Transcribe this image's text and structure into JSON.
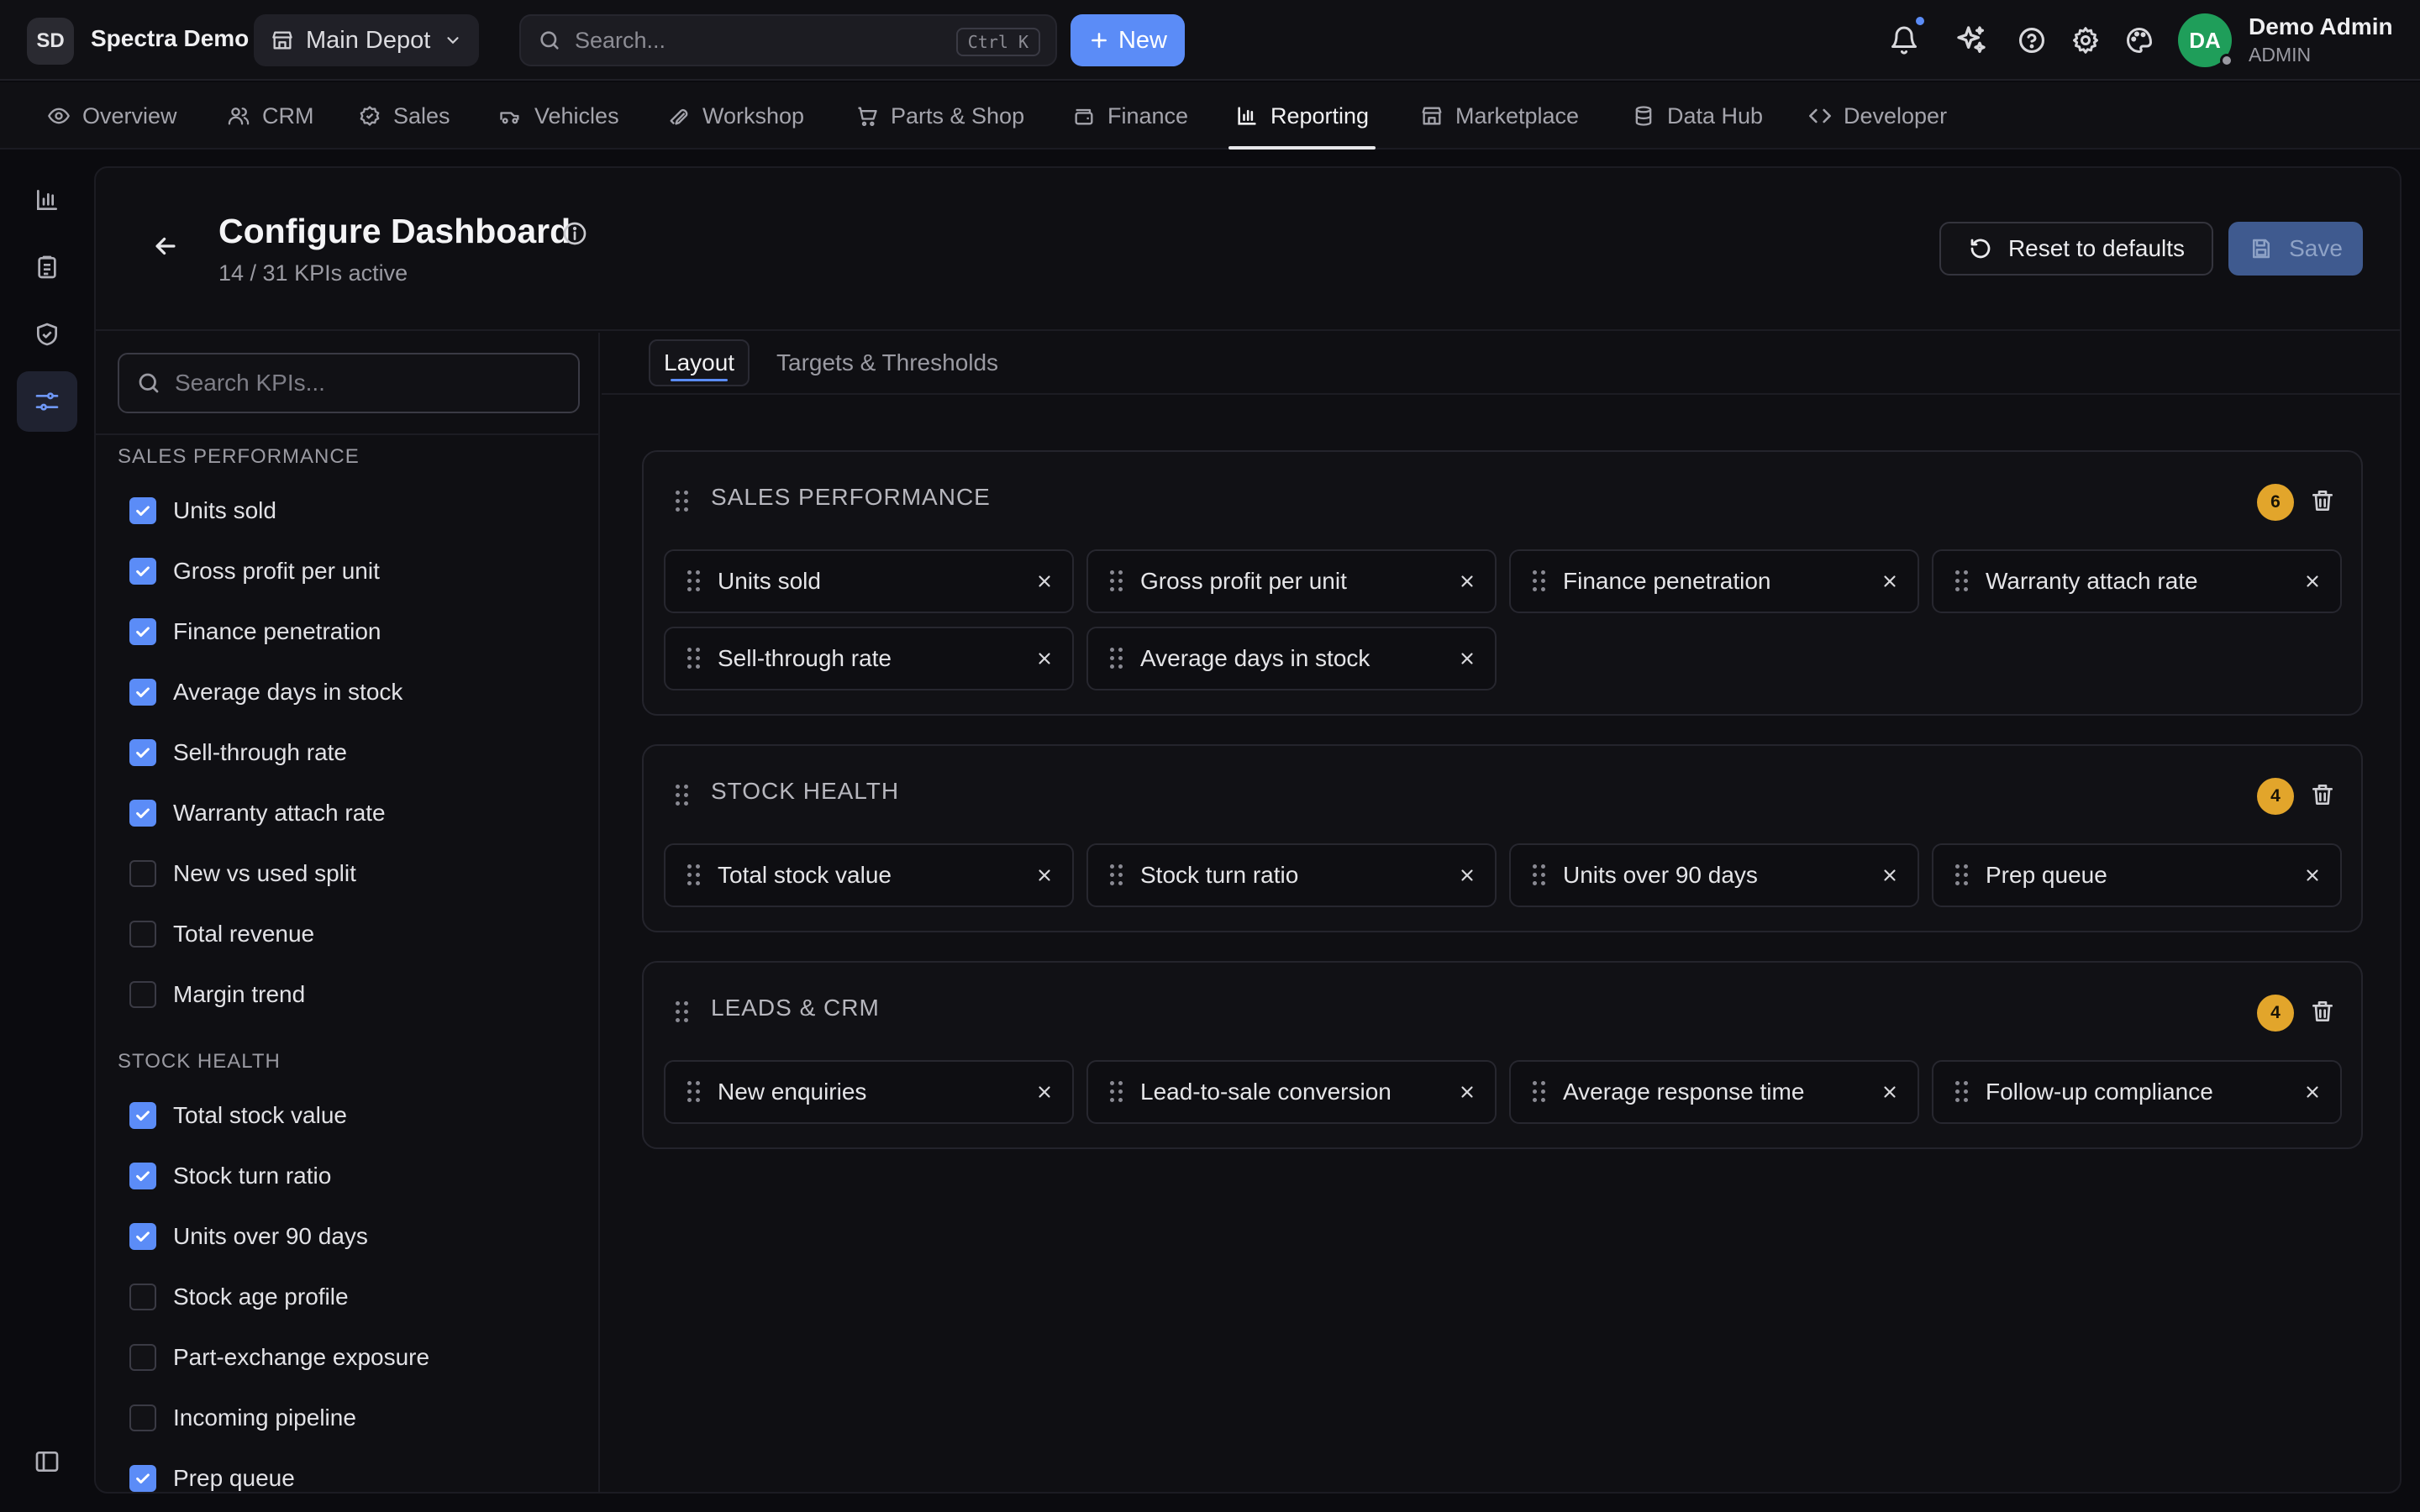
{
  "brand": {
    "badge": "SD",
    "name": "Spectra Demo"
  },
  "depot": {
    "label": "Main Depot"
  },
  "search": {
    "placeholder": "Search...",
    "shortcut": "Ctrl K"
  },
  "new_button": {
    "label": "New"
  },
  "user": {
    "initials": "DA",
    "name": "Demo Admin",
    "role": "ADMIN"
  },
  "nav": [
    {
      "label": "Overview",
      "icon": "eye-icon"
    },
    {
      "label": "CRM",
      "icon": "users-icon"
    },
    {
      "label": "Sales",
      "icon": "tag-icon"
    },
    {
      "label": "Vehicles",
      "icon": "car-icon"
    },
    {
      "label": "Workshop",
      "icon": "wrench-icon"
    },
    {
      "label": "Parts & Shop",
      "icon": "cart-icon"
    },
    {
      "label": "Finance",
      "icon": "wallet-icon"
    },
    {
      "label": "Reporting",
      "icon": "bar-chart-icon",
      "active": true
    },
    {
      "label": "Marketplace",
      "icon": "store-icon"
    },
    {
      "label": "Data Hub",
      "icon": "database-icon"
    },
    {
      "label": "Developer",
      "icon": "code-icon"
    }
  ],
  "page": {
    "title": "Configure Dashboard",
    "subtitle": "14 / 31 KPIs active",
    "reset_label": "Reset to defaults",
    "save_label": "Save"
  },
  "kpi_search": {
    "placeholder": "Search KPIs..."
  },
  "categories": [
    {
      "name": "SALES PERFORMANCE",
      "items": [
        {
          "label": "Units sold",
          "checked": true
        },
        {
          "label": "Gross profit per unit",
          "checked": true
        },
        {
          "label": "Finance penetration",
          "checked": true
        },
        {
          "label": "Average days in stock",
          "checked": true
        },
        {
          "label": "Sell-through rate",
          "checked": true
        },
        {
          "label": "Warranty attach rate",
          "checked": true
        },
        {
          "label": "New vs used split",
          "checked": false
        },
        {
          "label": "Total revenue",
          "checked": false
        },
        {
          "label": "Margin trend",
          "checked": false
        }
      ]
    },
    {
      "name": "STOCK HEALTH",
      "items": [
        {
          "label": "Total stock value",
          "checked": true
        },
        {
          "label": "Stock turn ratio",
          "checked": true
        },
        {
          "label": "Units over 90 days",
          "checked": true
        },
        {
          "label": "Stock age profile",
          "checked": false
        },
        {
          "label": "Part-exchange exposure",
          "checked": false
        },
        {
          "label": "Incoming pipeline",
          "checked": false
        },
        {
          "label": "Prep queue",
          "checked": true
        }
      ]
    }
  ],
  "tabs": [
    {
      "label": "Layout",
      "active": true
    },
    {
      "label": "Targets & Thresholds",
      "active": false
    }
  ],
  "groups": [
    {
      "name": "SALES PERFORMANCE",
      "count": "6",
      "kpis": [
        "Units sold",
        "Gross profit per unit",
        "Finance penetration",
        "Warranty attach rate",
        "Sell-through rate",
        "Average days in stock"
      ]
    },
    {
      "name": "STOCK HEALTH",
      "count": "4",
      "kpis": [
        "Total stock value",
        "Stock turn ratio",
        "Units over 90 days",
        "Prep queue"
      ]
    },
    {
      "name": "LEADS & CRM",
      "count": "4",
      "kpis": [
        "New enquiries",
        "Lead-to-sale conversion",
        "Average response time",
        "Follow-up compliance"
      ]
    }
  ],
  "colors": {
    "accent": "#5b8cf7",
    "badge": "#e2a52b",
    "avatar": "#1f9e5a"
  }
}
